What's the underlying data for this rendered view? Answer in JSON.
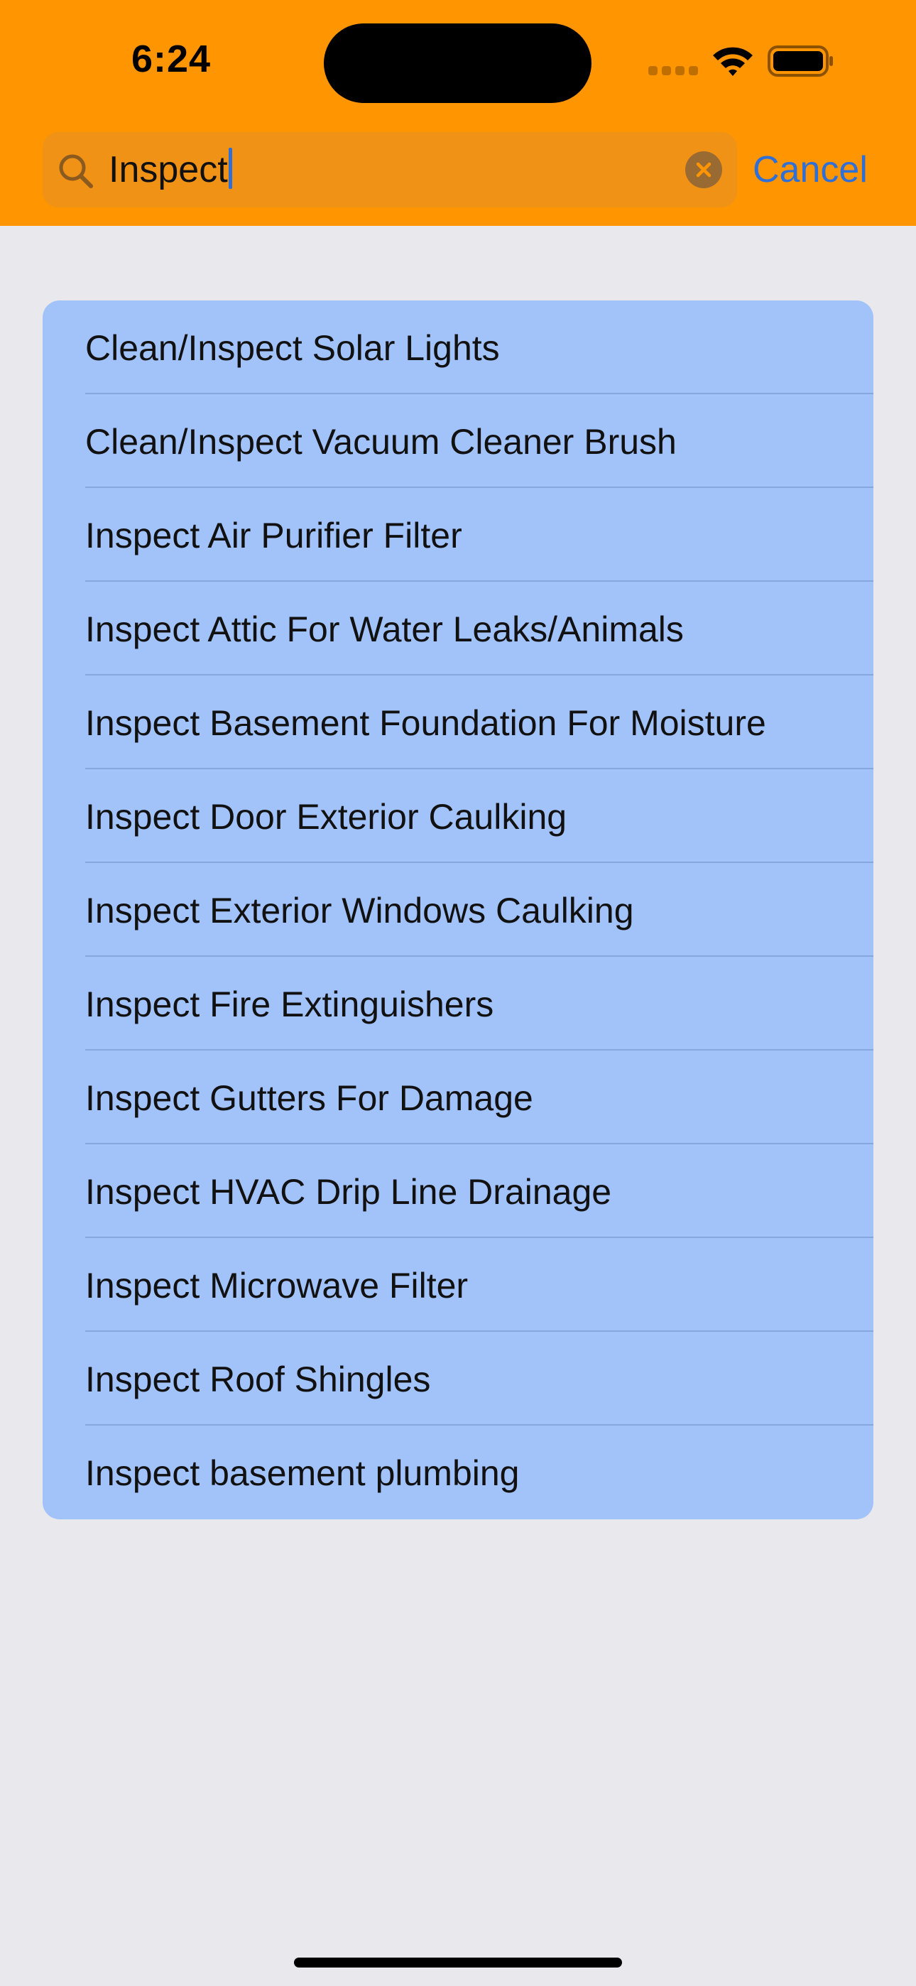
{
  "status_bar": {
    "time": "6:24"
  },
  "search": {
    "query": "Inspect",
    "cancel_label": "Cancel"
  },
  "results": [
    "Clean/Inspect Solar Lights",
    "Clean/Inspect Vacuum Cleaner Brush",
    "Inspect Air Purifier Filter",
    "Inspect Attic For Water Leaks/Animals",
    "Inspect Basement Foundation For Moisture",
    "Inspect Door Exterior Caulking",
    "Inspect Exterior Windows Caulking",
    "Inspect Fire Extinguishers",
    "Inspect Gutters For Damage",
    "Inspect HVAC Drip Line Drainage",
    "Inspect Microwave Filter",
    "Inspect Roof Shingles",
    "Inspect basement plumbing"
  ],
  "icons": {
    "search": "magnifying-glass-icon",
    "clear": "x-circle-icon",
    "wifi": "wifi-icon",
    "battery": "battery-icon",
    "signal": "cellular-signal-icon"
  },
  "colors": {
    "header": "#FF9500",
    "search_field": "#EF9215",
    "accent": "#2F6FD6",
    "list_background": "#A2C2FA",
    "page_background": "#E8E8ED"
  }
}
